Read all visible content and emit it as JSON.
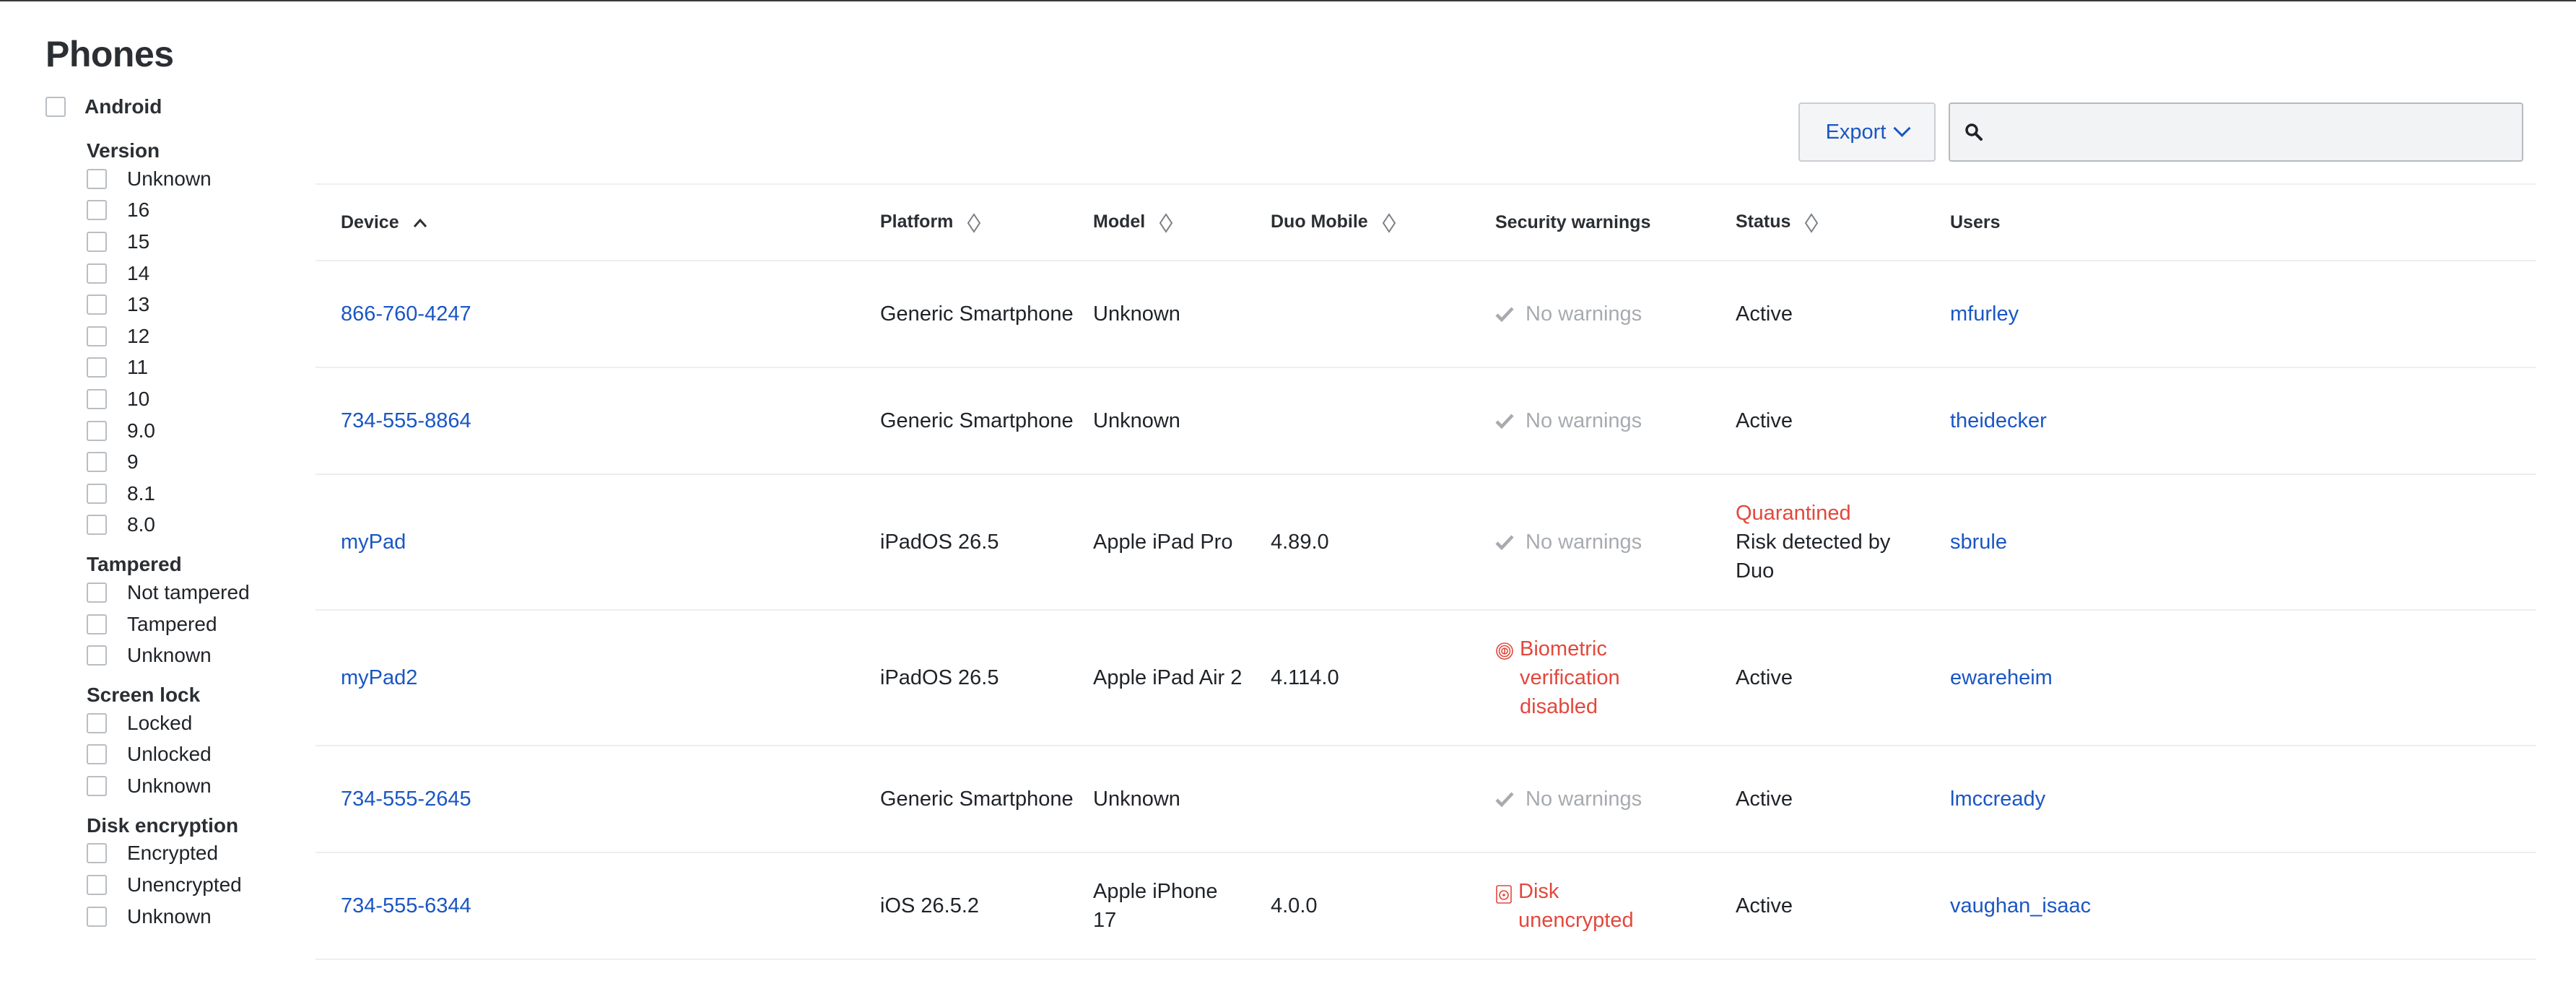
{
  "page": {
    "title": "Phones"
  },
  "filters": {
    "android": {
      "label": "Android"
    },
    "groups": [
      {
        "title": "Version",
        "options": [
          "Unknown",
          "16",
          "15",
          "14",
          "13",
          "12",
          "11",
          "10",
          "9.0",
          "9",
          "8.1",
          "8.0"
        ]
      },
      {
        "title": "Tampered",
        "options": [
          "Not tampered",
          "Tampered",
          "Unknown"
        ]
      },
      {
        "title": "Screen lock",
        "options": [
          "Locked",
          "Unlocked",
          "Unknown"
        ]
      },
      {
        "title": "Disk encryption",
        "options": [
          "Encrypted",
          "Unencrypted",
          "Unknown"
        ]
      }
    ]
  },
  "toolbar": {
    "export_label": "Export",
    "search_placeholder": ""
  },
  "table": {
    "columns": [
      "Device",
      "Platform",
      "Model",
      "Duo Mobile",
      "Security warnings",
      "Status",
      "Users"
    ],
    "rows": [
      {
        "device": "866-760-4247",
        "platform": "Generic Smartphone",
        "model": "Unknown",
        "duo": "",
        "warning": "No warnings",
        "warning_type": "none",
        "status": "Active",
        "status_extra": "",
        "user": "mfurley"
      },
      {
        "device": "734-555-8864",
        "platform": "Generic Smartphone",
        "model": "Unknown",
        "duo": "",
        "warning": "No warnings",
        "warning_type": "none",
        "status": "Active",
        "status_extra": "",
        "user": "theidecker"
      },
      {
        "device": "myPad",
        "platform": "iPadOS 26.5",
        "model": "Apple iPad Pro",
        "duo": "4.89.0",
        "warning": "No warnings",
        "warning_type": "none",
        "status": "Quarantined",
        "status_extra": "Risk detected by Duo",
        "user": "sbrule"
      },
      {
        "device": "myPad2",
        "platform": "iPadOS 26.5",
        "model": "Apple iPad Air 2",
        "duo": "4.114.0",
        "warning": "Biometric verification disabled",
        "warning_type": "biometric",
        "status": "Active",
        "status_extra": "",
        "user": "ewareheim"
      },
      {
        "device": "734-555-2645",
        "platform": "Generic Smartphone",
        "model": "Unknown",
        "duo": "",
        "warning": "No warnings",
        "warning_type": "none",
        "status": "Active",
        "status_extra": "",
        "user": "lmccready"
      },
      {
        "device": "734-555-6344",
        "platform": "iOS 26.5.2",
        "model": "Apple iPhone 17",
        "duo": "4.0.0",
        "warning": "Disk unencrypted",
        "warning_type": "disk",
        "status": "Active",
        "status_extra": "",
        "user": "vaughan_isaac"
      }
    ]
  },
  "colors": {
    "link": "#1a56c4",
    "danger": "#e2483d",
    "muted": "#a7abb0"
  }
}
